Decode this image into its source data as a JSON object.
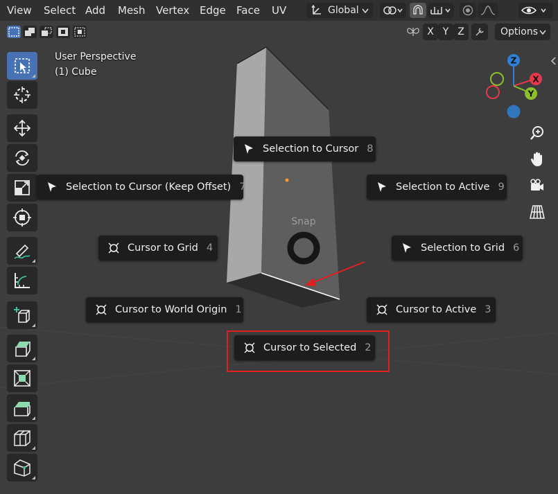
{
  "header": {
    "menus": [
      "View",
      "Select",
      "Add",
      "Mesh",
      "Vertex",
      "Edge",
      "Face",
      "UV"
    ],
    "transform_orientation": "Global"
  },
  "toolbar2": {
    "axes": [
      "X",
      "Y",
      "Z"
    ],
    "options_label": "Options"
  },
  "overlay": {
    "view_name": "User Perspective",
    "object_name": "(1) Cube"
  },
  "gizmo": {
    "axes": [
      "Z",
      "X",
      "Y"
    ],
    "colors": {
      "x": "#e5394b",
      "y": "#8cbf2c",
      "z": "#2f7fd6"
    }
  },
  "pie_menu": {
    "title": "Snap",
    "items": [
      {
        "label": "Selection to Cursor",
        "key": "8",
        "icon": "cursor-arrow-icon"
      },
      {
        "label": "Selection to Cursor (Keep Offset)",
        "key": "7",
        "icon": "cursor-arrow-icon"
      },
      {
        "label": "Selection to Active",
        "key": "9",
        "icon": "cursor-arrow-icon"
      },
      {
        "label": "Cursor to Grid",
        "key": "4",
        "icon": "3d-cursor-icon"
      },
      {
        "label": "Selection to Grid",
        "key": "6",
        "icon": "cursor-arrow-icon"
      },
      {
        "label": "Cursor to World Origin",
        "key": "1",
        "icon": "3d-cursor-icon"
      },
      {
        "label": "Cursor to Active",
        "key": "3",
        "icon": "3d-cursor-icon"
      },
      {
        "label": "Cursor to Selected",
        "key": "2",
        "icon": "3d-cursor-icon"
      }
    ]
  },
  "annotation": {
    "highlighted_item": "Cursor to Selected",
    "color": "#e02020"
  },
  "colors": {
    "viewport_bg": "#3d3d3d",
    "header_bg": "#303030",
    "active_tool": "#4772b3",
    "pie_item_bg": "#1d1d1d"
  }
}
